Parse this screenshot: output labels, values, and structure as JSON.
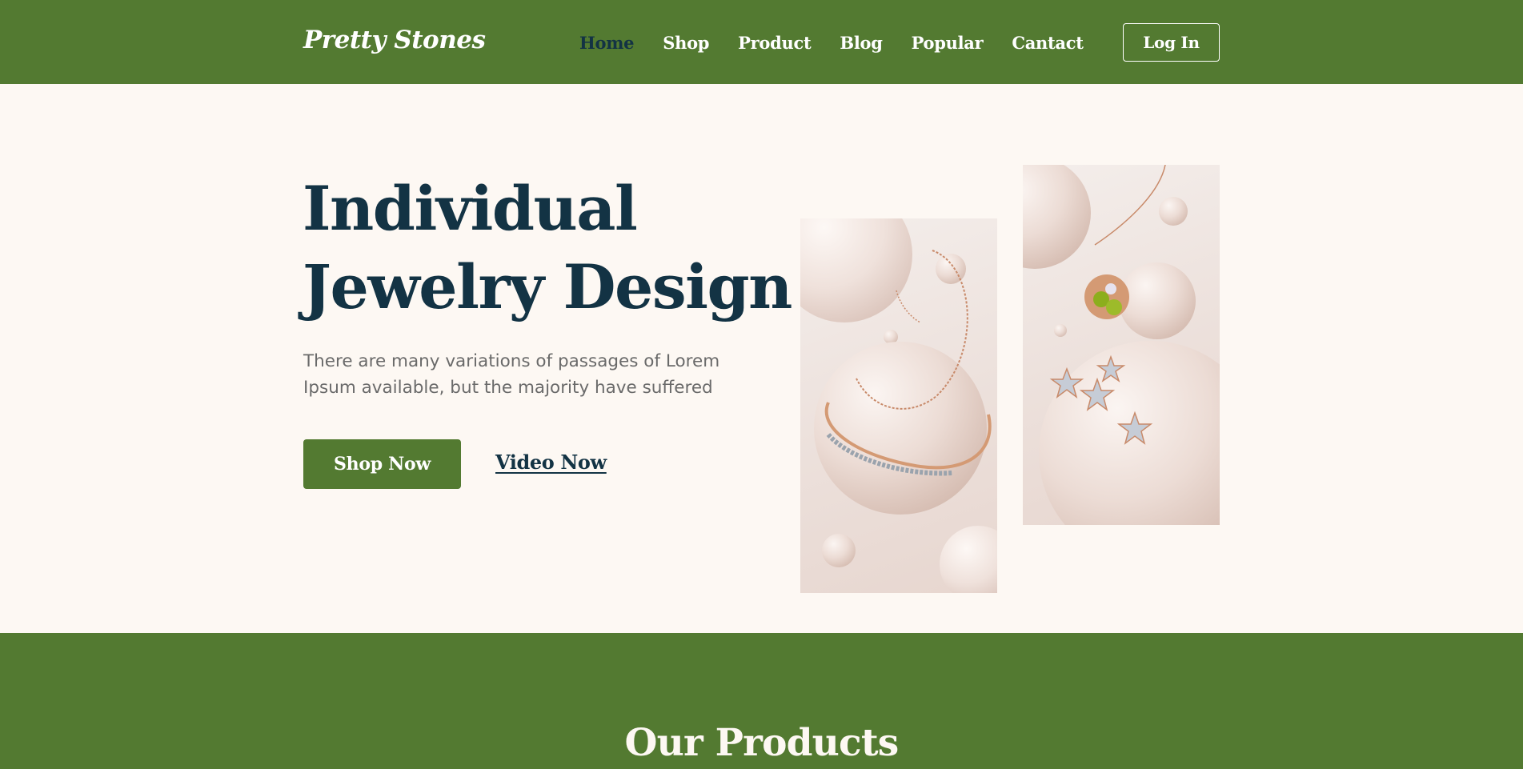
{
  "brand": {
    "name": "Pretty Stones",
    "primary_color": "#537a31",
    "text_dark": "#133344",
    "background": "#fdf8f3"
  },
  "nav": {
    "items": [
      {
        "label": "Home",
        "active": true
      },
      {
        "label": "Shop"
      },
      {
        "label": "Product"
      },
      {
        "label": "Blog"
      },
      {
        "label": "Popular"
      },
      {
        "label": "Cantact"
      }
    ],
    "login_label": "Log In"
  },
  "hero": {
    "title_line1": "Individual",
    "title_line2": "Jewelry Design",
    "description": "There are many variations of passages of Lorem Ipsum available, but the majority have suffered",
    "primary_button": "Shop Now",
    "secondary_link": "Video Now",
    "images": [
      "bracelet-with-pearls-photo",
      "pendant-and-star-earrings-photo"
    ]
  },
  "products": {
    "title": "Our Products"
  }
}
